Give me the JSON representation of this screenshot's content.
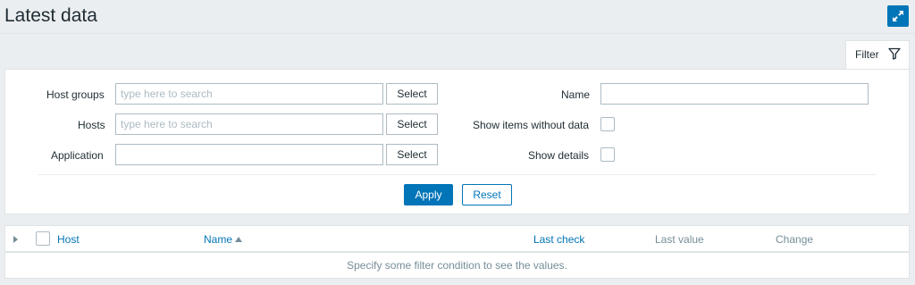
{
  "page": {
    "title": "Latest data"
  },
  "filter": {
    "tab_label": "Filter",
    "host_groups": {
      "label": "Host groups",
      "placeholder": "type here to search",
      "value": "",
      "button": "Select"
    },
    "hosts": {
      "label": "Hosts",
      "placeholder": "type here to search",
      "value": "",
      "button": "Select"
    },
    "application": {
      "label": "Application",
      "value": "",
      "button": "Select"
    },
    "name": {
      "label": "Name",
      "value": ""
    },
    "show_items_without_data": {
      "label": "Show items without data",
      "checked": false
    },
    "show_details": {
      "label": "Show details",
      "checked": false
    },
    "apply_label": "Apply",
    "reset_label": "Reset"
  },
  "table": {
    "columns": [
      {
        "label": "Host",
        "style": "link"
      },
      {
        "label": "Name",
        "style": "link",
        "sorted": "asc"
      },
      {
        "label": "Last check",
        "style": "link"
      },
      {
        "label": "Last value",
        "style": "muted"
      },
      {
        "label": "Change",
        "style": "muted"
      }
    ],
    "empty_message": "Specify some filter condition to see the values."
  },
  "colors": {
    "accent": "#0275b8",
    "background": "#ebeef0",
    "border": "#dfe4e7",
    "muted_text": "#768d99"
  },
  "icons": [
    "fullscreen-icon",
    "filter-icon",
    "expand-arrow-icon",
    "sort-ascending-icon"
  ]
}
